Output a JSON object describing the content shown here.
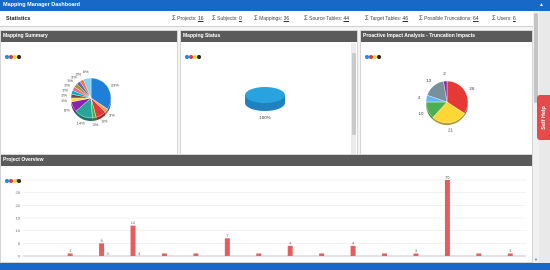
{
  "window": {
    "title": "Mapping Manager Dashboard",
    "collapse_icon": "chevron-up-icon"
  },
  "stats": {
    "label": "Statistics",
    "items": [
      {
        "label": "Projects:",
        "value": "16"
      },
      {
        "label": "Subjects:",
        "value": "0"
      },
      {
        "label": "Mappings:",
        "value": "36"
      },
      {
        "label": "Source Tables:",
        "value": "44"
      },
      {
        "label": "Target Tables:",
        "value": "46"
      },
      {
        "label": "Possible Truncations:",
        "value": "64"
      },
      {
        "label": "Users:",
        "value": "6"
      }
    ]
  },
  "legend_dot_colors": [
    "#1e88e5",
    "#e53935",
    "#fdd835",
    "#222222"
  ],
  "panels": {
    "mapping_summary": {
      "title": "Mapping Summary"
    },
    "mapping_status": {
      "title": "Mapping Status",
      "label": "100%"
    },
    "impact": {
      "title": "Proactive Impact Analysis - Truncation Impacts"
    },
    "overview": {
      "title": "Project Overview"
    }
  },
  "help_tab": {
    "label": "Self Help"
  },
  "chart_data": [
    {
      "type": "pie",
      "title": "Mapping Summary",
      "slice_labels": [
        "33%",
        "3%",
        "8%",
        "3%",
        "14%",
        "8%",
        "3%",
        "3%",
        "3%",
        "3%",
        "3%",
        "3%",
        "3%",
        "6%"
      ],
      "colors": [
        "#1e7fd8",
        "#f4a261",
        "#e53935",
        "#4caf50",
        "#26a69a",
        "#8e24aa",
        "#fdd835",
        "#6d4c41",
        "#00acc1",
        "#f06292",
        "#9e9d24",
        "#5c6bc0",
        "#ff7043",
        "#81d4fa"
      ]
    },
    {
      "type": "pie",
      "title": "Mapping Status",
      "values": [
        100
      ],
      "slice_labels": [
        "100%"
      ],
      "colors": [
        "#29a3e0"
      ]
    },
    {
      "type": "pie",
      "title": "Proactive Impact Analysis - Truncation Impacts",
      "values": [
        26,
        21,
        10,
        4,
        13,
        2
      ],
      "slice_labels": [
        "26",
        "21",
        "10",
        "4",
        "13",
        "2"
      ],
      "colors": [
        "#e53935",
        "#fdd835",
        "#4caf50",
        "#64b5f6",
        "#78909c",
        "#8e24aa"
      ]
    },
    {
      "type": "bar",
      "title": "Project Overview",
      "categories": [
        "1",
        "2",
        "3",
        "4",
        "5",
        "6",
        "7",
        "8",
        "9",
        "10",
        "11",
        "12",
        "13",
        "14",
        "15",
        "16"
      ],
      "values": [
        0,
        1,
        5,
        12,
        1,
        1,
        7,
        1,
        4,
        1,
        4,
        1,
        1,
        35,
        1,
        1
      ],
      "data_labels": [
        "",
        "1",
        "5",
        "12",
        "",
        "",
        "7",
        "",
        "4",
        "",
        "4",
        "",
        "3",
        "35",
        "",
        "3"
      ],
      "extra_labels": [
        "",
        "",
        "3",
        "3",
        "",
        "",
        "",
        "",
        "",
        "",
        "",
        "",
        "",
        "",
        "",
        ""
      ],
      "ylim": [
        0,
        30
      ],
      "yticks": [
        "0",
        "5",
        "10",
        "15",
        "20",
        "25",
        "30"
      ],
      "bar_color": "#e85c5c",
      "grid": true
    }
  ]
}
